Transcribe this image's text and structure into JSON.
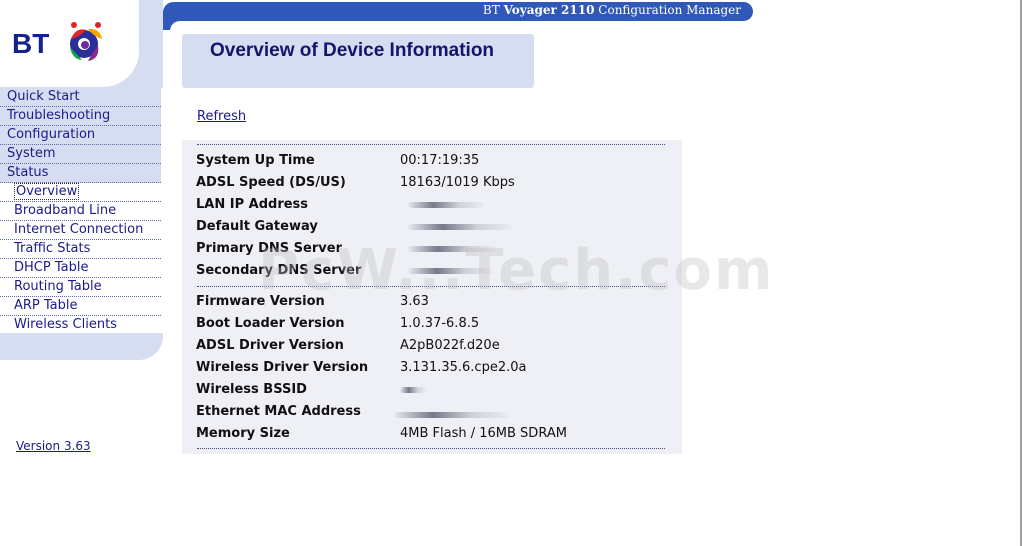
{
  "header": {
    "brand": "BT",
    "product": "Voyager 2110",
    "suffix": "Configuration Manager"
  },
  "logo": {
    "text": "BT"
  },
  "sidebar": {
    "items": [
      {
        "label": "Quick Start",
        "level": "top"
      },
      {
        "label": "Troubleshooting",
        "level": "top"
      },
      {
        "label": "Configuration",
        "level": "top"
      },
      {
        "label": "System",
        "level": "top"
      },
      {
        "label": "Status",
        "level": "top"
      },
      {
        "label": "Overview",
        "level": "sub",
        "active": true
      },
      {
        "label": "Broadband Line",
        "level": "sub"
      },
      {
        "label": "Internet Connection",
        "level": "sub"
      },
      {
        "label": "Traffic Stats",
        "level": "sub"
      },
      {
        "label": "DHCP Table",
        "level": "sub"
      },
      {
        "label": "Routing Table",
        "level": "sub"
      },
      {
        "label": "ARP Table",
        "level": "sub"
      },
      {
        "label": "Wireless Clients",
        "level": "sub"
      }
    ],
    "version": "Version 3.63"
  },
  "main": {
    "title": "Overview of Device Information",
    "refresh": "Refresh",
    "rows": [
      {
        "label": "System Up Time",
        "value": "00:17:19:35"
      },
      {
        "label": "ADSL Speed (DS/US)",
        "value": "18163/1019 Kbps"
      },
      {
        "label": "LAN IP Address",
        "value": ""
      },
      {
        "label": "Default Gateway",
        "value": ""
      },
      {
        "label": "Primary DNS Server",
        "value": ""
      },
      {
        "label": "Secondary DNS Server",
        "value": ""
      },
      {
        "label": "Firmware Version",
        "value": "3.63"
      },
      {
        "label": "Boot Loader Version",
        "value": "1.0.37-6.8.5"
      },
      {
        "label": "ADSL Driver Version",
        "value": "A2pB022f.d20e"
      },
      {
        "label": "Wireless Driver Version",
        "value": "3.131.35.6.cpe2.0a"
      },
      {
        "label": "Wireless BSSID",
        "value": ""
      },
      {
        "label": "Ethernet MAC Address",
        "value": ""
      },
      {
        "label": "Memory Size",
        "value": "4MB Flash / 16MB SDRAM"
      }
    ]
  },
  "watermark": "PcW...Tech.com",
  "colors": {
    "header_blue": "#2f58b8",
    "sidebar_bg": "#d7ddf0",
    "link": "#1b1b8a",
    "title": "#14146e",
    "panel_bg": "#eef0f6"
  }
}
